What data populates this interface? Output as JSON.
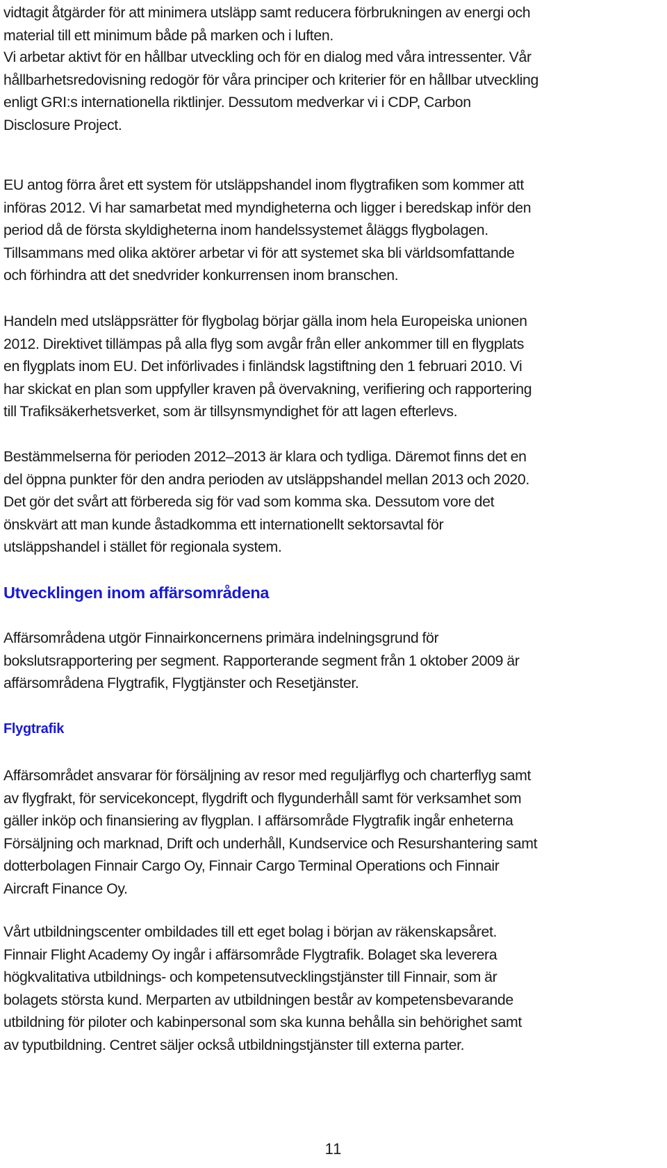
{
  "document": {
    "paragraphs_top": [
      "vidtagit åtgärder för att minimera utsläpp samt reducera förbrukningen av energi och\nmaterial till ett minimum både på marken och i luften.",
      "Vi arbetar aktivt för en hållbar utveckling och för en dialog med våra intressenter. Vår\nhållbarhetsredovisning redogör för våra principer och kriterier för en hållbar utveckling\nenligt GRI:s internationella riktlinjer. Dessutom medverkar vi i CDP, Carbon\nDisclosure Project.",
      "EU antog förra året ett system för utsläppshandel inom flygtrafiken som kommer att\ninföras 2012. Vi har samarbetat med myndigheterna och ligger i beredskap inför den\nperiod då de första skyldigheterna inom handelssystemet åläggs flygbolagen.\nTillsammans med olika aktörer arbetar vi för att systemet ska bli världsomfattande\noch förhindra att det snedvrider konkurrensen inom branschen.",
      "Handeln med utsläppsrätter för flygbolag börjar gälla inom hela Europeiska unionen\n2012. Direktivet tillämpas på alla flyg som avgår från eller ankommer till en flygplats\nen flygplats inom EU. Det införlivades i finländsk lagstiftning den 1 februari 2010. Vi\nhar skickat en plan som uppfyller kraven på övervakning, verifiering och rapportering\ntill Trafiksäkerhetsverket, som är tillsynsmyndighet för att lagen efterlevs.",
      "Bestämmelserna för perioden 2012–2013 är klara och tydliga. Däremot finns det en\ndel öppna punkter för den andra perioden av utsläppshandel mellan 2013 och 2020.\nDet gör det svårt att förbereda sig för vad som komma ska. Dessutom vore det\nönskvärt att man kunde åstadkomma ett internationellt sektorsavtal för\nutsläppshandel i stället för regionala system."
    ],
    "section_heading": "Utvecklingen inom affärsområdena",
    "section_paragraph": "Affärsområdena utgör Finnairkoncernens primära indelningsgrund för\nbokslutsrapportering per segment. Rapporterande segment från 1 oktober 2009 är\naffärsområdena Flygtrafik, Flygtjänster och Resetjänster.",
    "subsection_heading": "Flygtrafik",
    "subsection_paragraphs": [
      "Affärsområdet ansvarar för försäljning av resor med reguljärflyg och charterflyg samt\nav flygfrakt, för servicekoncept, flygdrift och flygunderhåll samt för verksamhet som\ngäller inköp och finansiering av flygplan. I affärsområde Flygtrafik ingår enheterna\nFörsäljning och marknad, Drift och underhåll, Kundservice och Resurshantering samt\ndotterbolagen Finnair Cargo Oy, Finnair Cargo Terminal Operations och Finnair\nAircraft Finance Oy.",
      "Vårt utbildningscenter ombildades till ett eget bolag i början av räkenskapsåret.\nFinnair Flight Academy Oy ingår i affärsområde Flygtrafik. Bolaget ska leverera\nhögkvalitativa utbildnings- och kompetensutvecklingstjänster till Finnair, som är\nbolagets största kund. Merparten av utbildningen består av kompetensbevarande\nutbildning för piloter och kabinpersonal som ska kunna behålla sin behörighet samt\nav typutbildning. Centret säljer också utbildningstjänster till externa parter."
    ],
    "page_number": "11"
  },
  "colors": {
    "heading": "#1a1acc",
    "body_text": "#1a1a1a"
  }
}
